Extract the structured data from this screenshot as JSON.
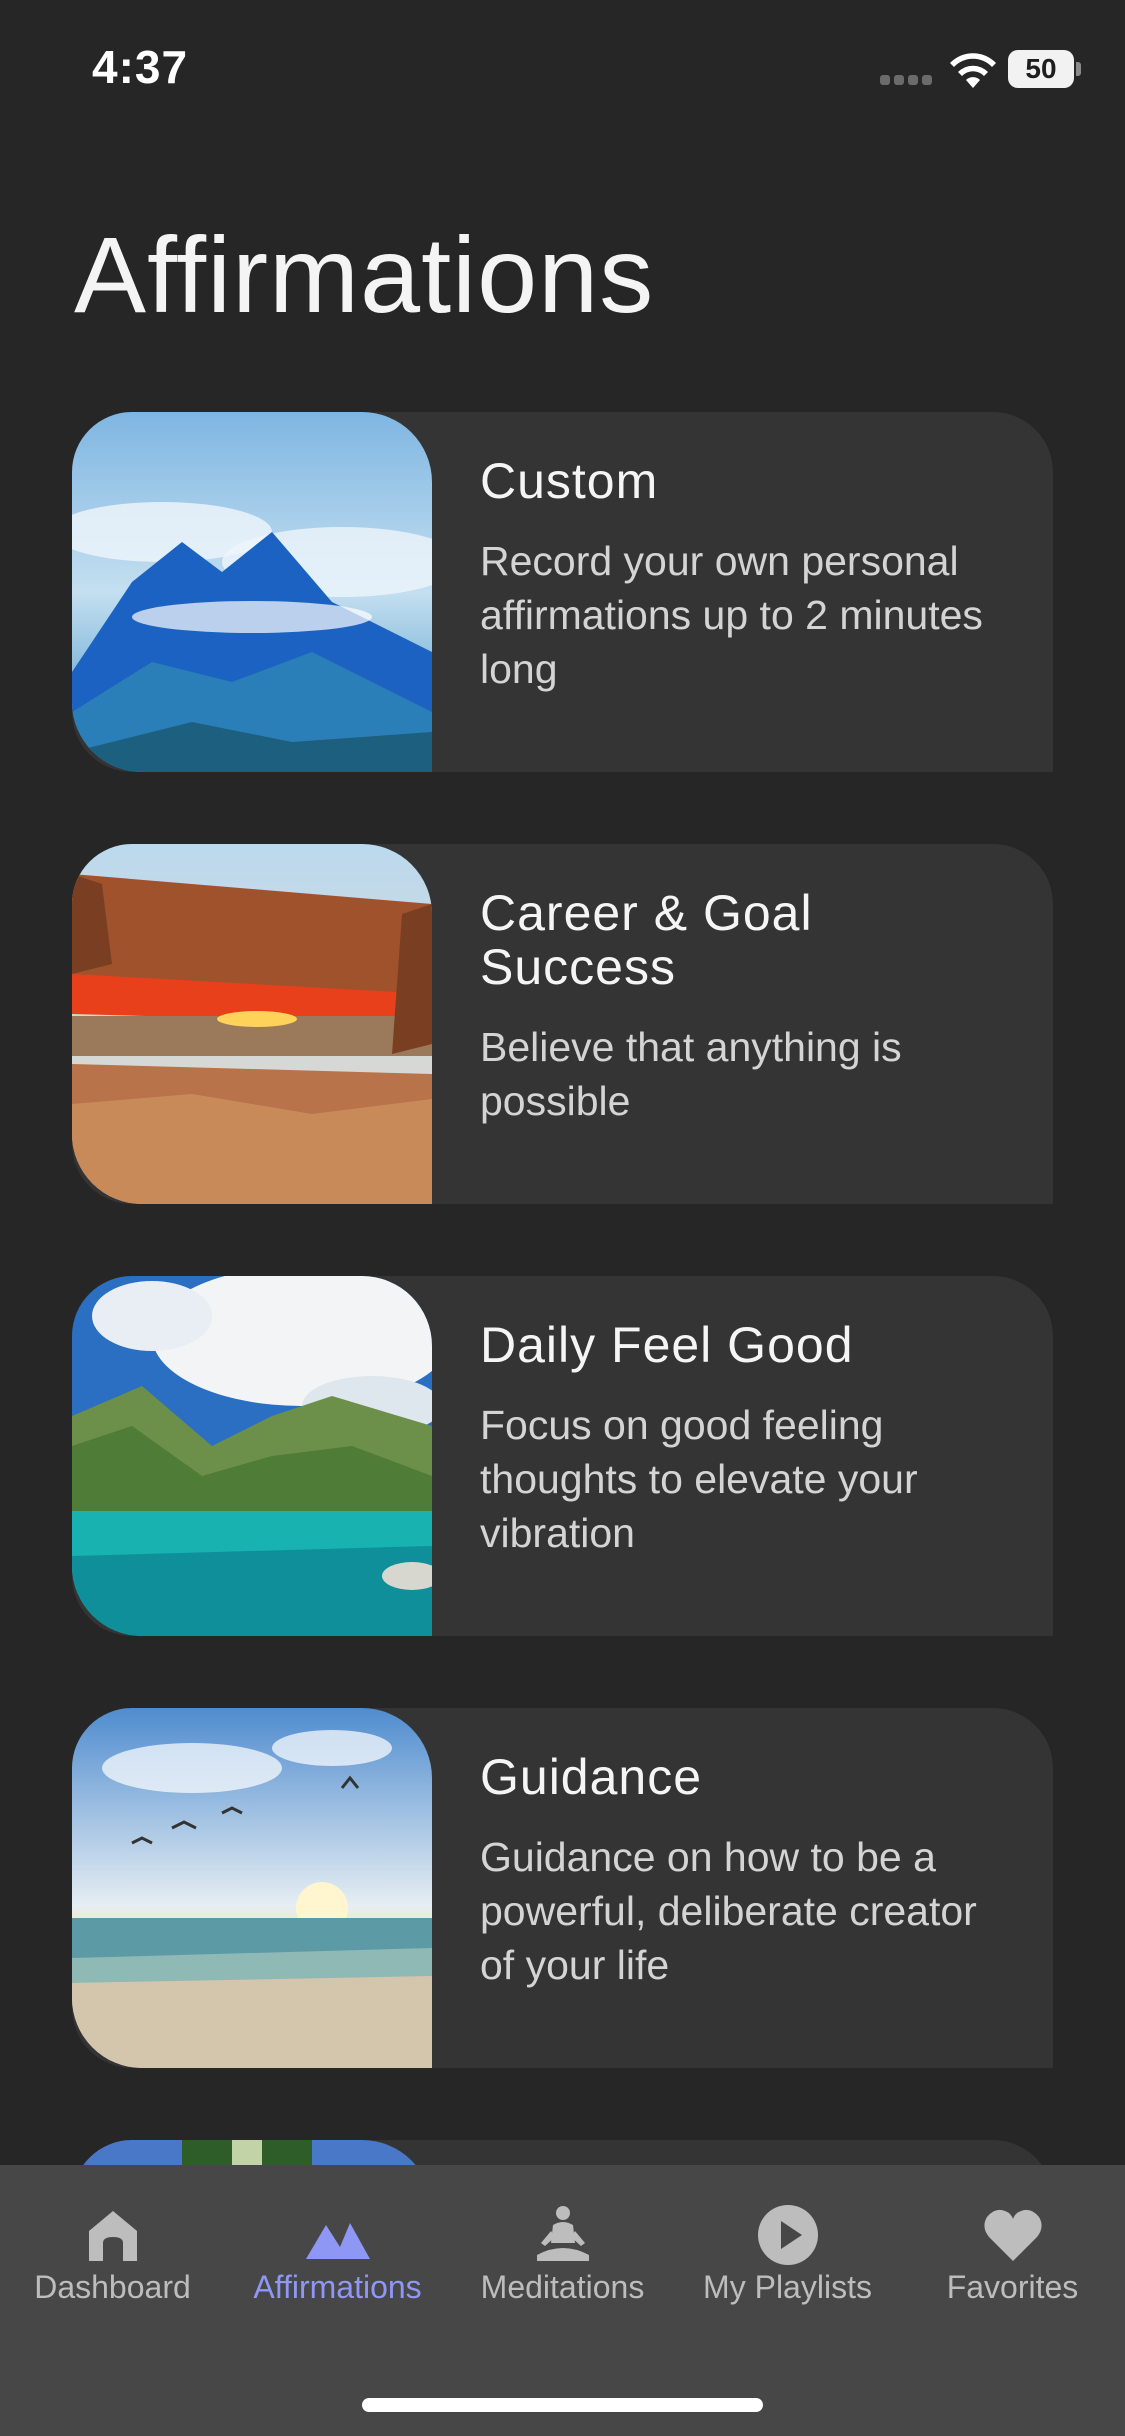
{
  "status_bar": {
    "time": "4:37",
    "battery": "50"
  },
  "page": {
    "title": "Affirmations"
  },
  "cards": [
    {
      "title": "Custom",
      "description": "Record your own personal affirmations up to 2 minutes long",
      "image": "mountains-above-clouds"
    },
    {
      "title": "Career & Goal Success",
      "description": "Believe that anything is possible",
      "image": "rock-arch-sunrise"
    },
    {
      "title": "Daily Feel Good",
      "description": "Focus on good feeling thoughts to elevate your vibration",
      "image": "mountain-lake"
    },
    {
      "title": "Guidance",
      "description": "Guidance on how to be a powerful, deliberate creator of your life",
      "image": "beach-sunset-birds"
    }
  ],
  "tab_bar": {
    "active": "Affirmations",
    "active_color": "#8f97f5",
    "tabs": [
      {
        "label": "Dashboard",
        "icon": "home-icon"
      },
      {
        "label": "Affirmations",
        "icon": "mountains-icon"
      },
      {
        "label": "Meditations",
        "icon": "meditation-icon"
      },
      {
        "label": "My Playlists",
        "icon": "play-icon"
      },
      {
        "label": "Favorites",
        "icon": "heart-icon"
      }
    ]
  }
}
